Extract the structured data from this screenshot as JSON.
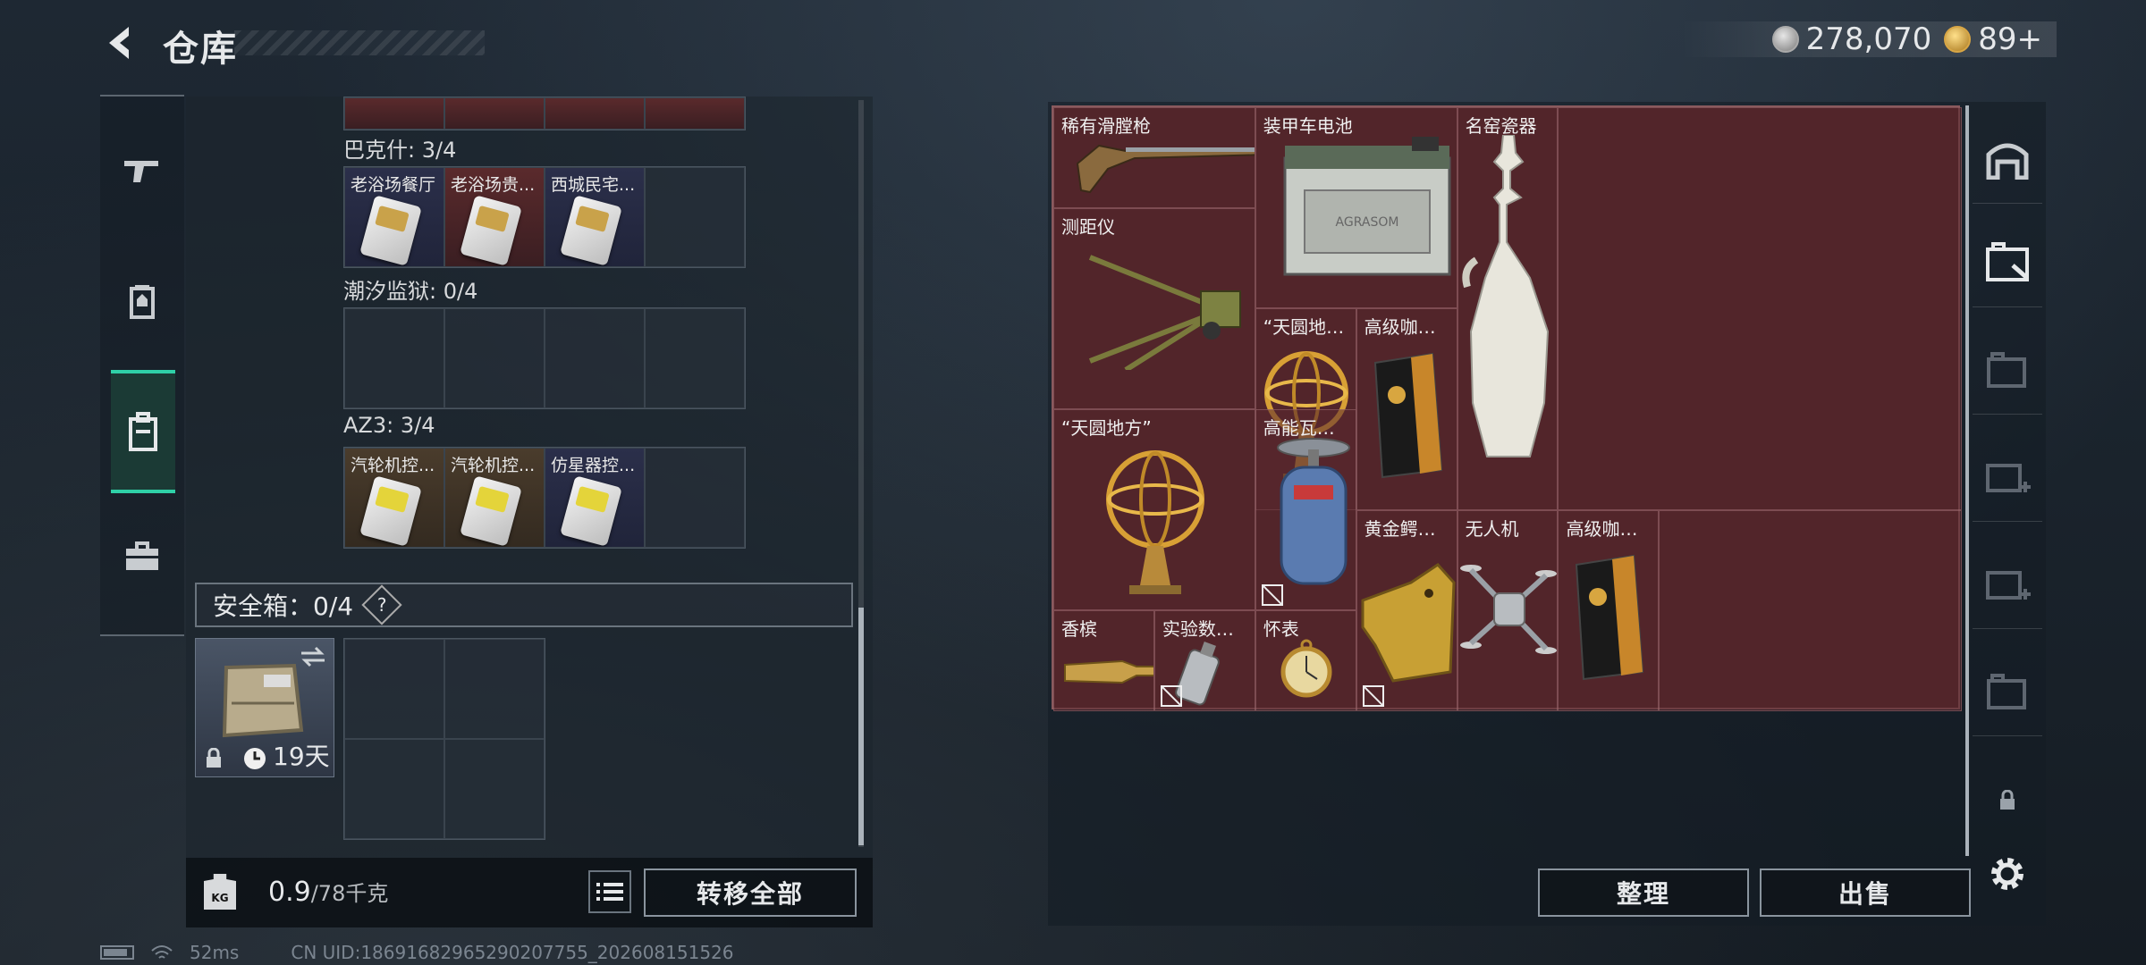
{
  "header": {
    "title": "仓库"
  },
  "currency": {
    "silver": "278,070",
    "gold": "89+"
  },
  "left_nav": [
    "gun-icon",
    "armor-icon",
    "backpack-icon",
    "toolbox-icon"
  ],
  "collections": [
    {
      "label": "巴克什: 3/4",
      "items": [
        "老浴场餐厅",
        "老浴场贵...",
        "西城民宅..."
      ],
      "styles": [
        "blue",
        "red",
        "blue"
      ]
    },
    {
      "label": "潮汐监狱: 0/4",
      "items": [],
      "styles": []
    },
    {
      "label": "AZ3: 3/4",
      "items": [
        "汽轮机控...",
        "汽轮机控...",
        "仿星器控..."
      ],
      "styles": [
        "brown",
        "brown",
        "blue"
      ]
    }
  ],
  "safe_box": {
    "label": "安全箱：0/4",
    "help": "?",
    "timer": "19天"
  },
  "footer": {
    "weight": "0.9",
    "weight_max": "/78千克",
    "kg_label": "KG",
    "transfer_all": "转移全部"
  },
  "stash_items": {
    "rifle": "稀有滑膛枪",
    "battery": "装甲车电池",
    "porcelain": "名窑瓷器",
    "rangefinder": "测距仪",
    "globe1": "“天圆地方”",
    "coffee1": "高级咖啡豆",
    "globe2": "“天圆地方”",
    "gas": "高能瓦斯罐",
    "croc": "黄金鳄鱼头",
    "drone": "无人机",
    "coffee2": "高级咖啡豆",
    "champagne": "香槟",
    "data": "实验数据...",
    "watch": "怀表"
  },
  "battery_text": "AGRASOM",
  "buttons": {
    "organize": "整理",
    "sell": "出售"
  },
  "status": {
    "ping": "52ms",
    "uid": "CN UID:18691682965290207755_202608151526"
  }
}
